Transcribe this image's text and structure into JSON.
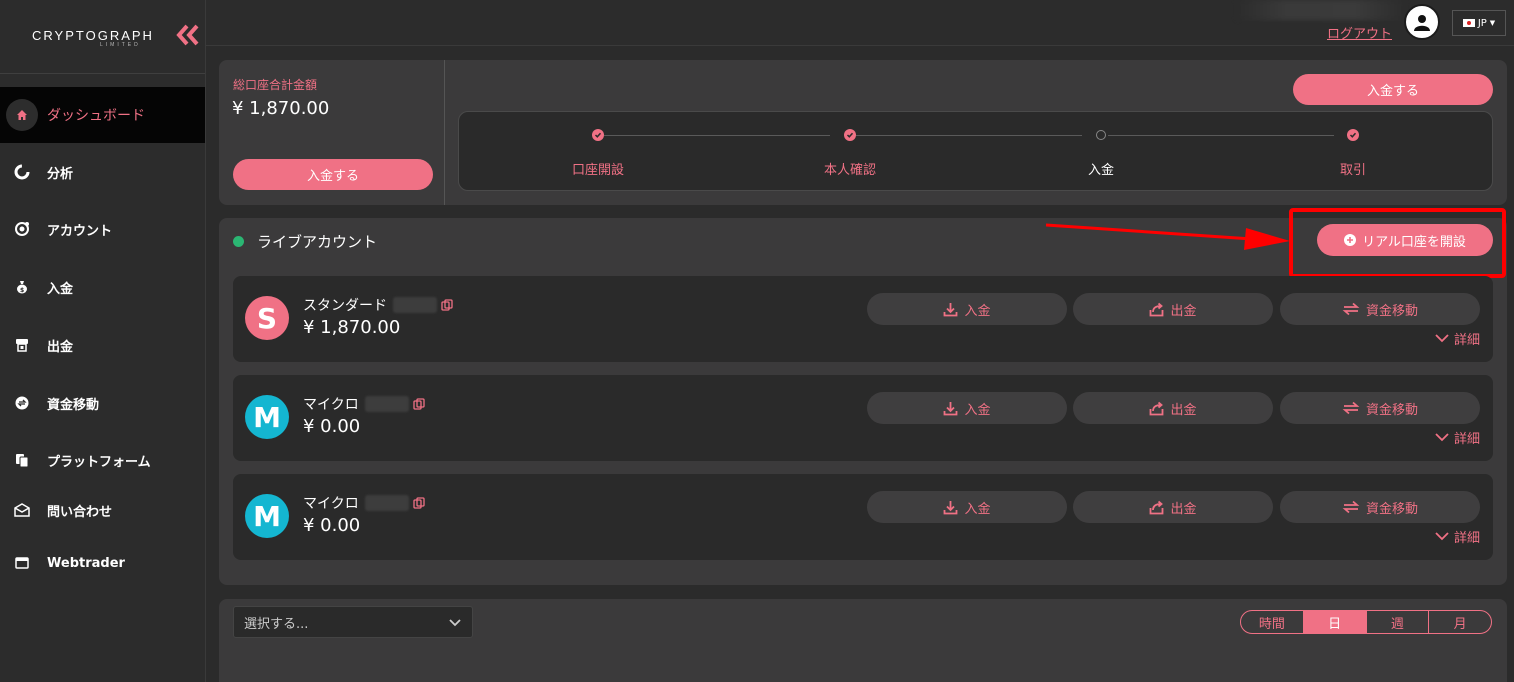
{
  "logo": {
    "name": "CRYPTOGRAPH",
    "sub": "LIMITED"
  },
  "sidebar": {
    "items": [
      {
        "label": "ダッシュボード",
        "icon": "home-icon",
        "active": true
      },
      {
        "label": "分析",
        "icon": "pie-chart-icon"
      },
      {
        "label": "アカウント",
        "icon": "account-icon"
      },
      {
        "label": "入金",
        "icon": "money-bag-icon"
      },
      {
        "label": "出金",
        "icon": "withdraw-icon"
      },
      {
        "label": "資金移動",
        "icon": "transfer-icon"
      },
      {
        "label": "プラットフォーム",
        "icon": "platform-icon"
      },
      {
        "label": "問い合わせ",
        "icon": "mail-icon"
      },
      {
        "label": "Webtrader",
        "icon": "window-icon"
      }
    ]
  },
  "header": {
    "logout": "ログアウト",
    "lang": "JP"
  },
  "summary": {
    "label": "総口座合計金額",
    "amount": "¥ 1,870.00",
    "deposit_btn": "入金する",
    "deposit_btn_top": "入金する"
  },
  "steps": [
    {
      "label": "口座開設",
      "done": true
    },
    {
      "label": "本人確認",
      "done": true
    },
    {
      "label": "入金",
      "done": false
    },
    {
      "label": "取引",
      "done": true
    }
  ],
  "live": {
    "title": "ライブアカウント",
    "open_btn": "リアル口座を開設"
  },
  "accounts": [
    {
      "initial": "S",
      "name": "スタンダード",
      "balance": "¥ 1,870.00",
      "color": "#f07185"
    },
    {
      "initial": "M",
      "name": "マイクロ",
      "balance": "¥ 0.00",
      "color": "#14b6d1"
    },
    {
      "initial": "M",
      "name": "マイクロ",
      "balance": "¥ 0.00",
      "color": "#14b6d1"
    }
  ],
  "account_actions": {
    "deposit": "入金",
    "withdraw": "出金",
    "transfer": "資金移動",
    "details": "詳細"
  },
  "bottom": {
    "select_placeholder": "選択する...",
    "periods": [
      "時間",
      "日",
      "週",
      "月"
    ],
    "active_period": "日"
  },
  "colors": {
    "accent": "#f07185",
    "live": "#2bb673",
    "micro": "#14b6d1"
  }
}
